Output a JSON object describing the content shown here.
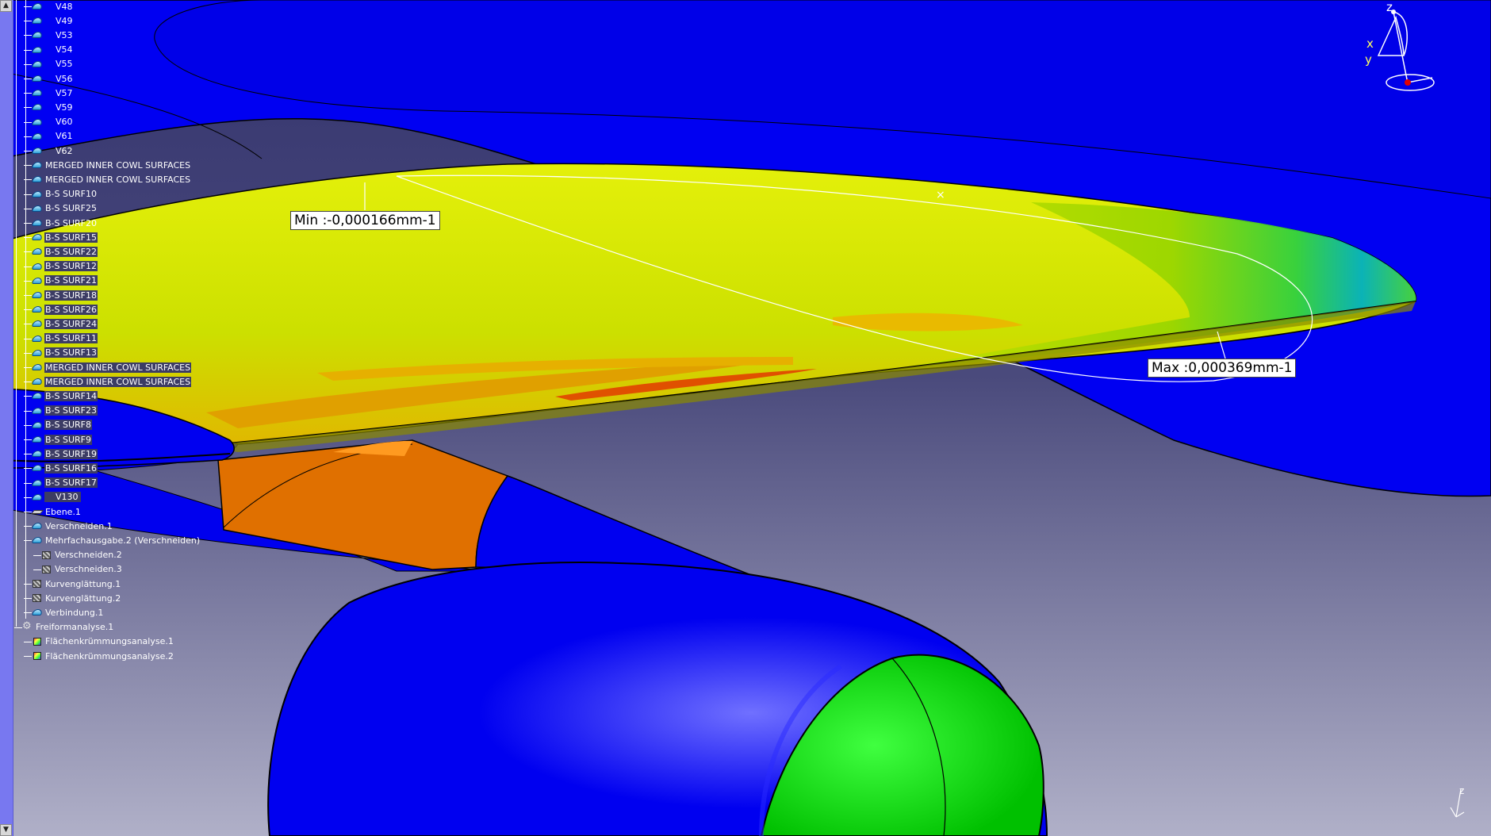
{
  "viewport": {
    "colors": {
      "background_top": "#3a3a72",
      "background_bottom": "#a8a8c4",
      "surface_blue": "#0000f0",
      "pylon_orange": "#e07000",
      "inlet_green": "#00e000"
    }
  },
  "analysis": {
    "min_label": "Min :-0,000166mm-1",
    "max_label": "Max :0,000369mm-1"
  },
  "compass": {
    "z": "z",
    "x": "x",
    "y": "y"
  },
  "mini_axis": {
    "z": "z"
  },
  "tree": {
    "items": [
      {
        "label": "V48",
        "type": "surf",
        "sel": false,
        "level": 1
      },
      {
        "label": "V49",
        "type": "surf",
        "sel": false,
        "level": 1
      },
      {
        "label": "V53",
        "type": "surf",
        "sel": false,
        "level": 1
      },
      {
        "label": "V54",
        "type": "surf",
        "sel": false,
        "level": 1
      },
      {
        "label": "V55",
        "type": "surf",
        "sel": false,
        "level": 1
      },
      {
        "label": "V56",
        "type": "surf",
        "sel": false,
        "level": 1
      },
      {
        "label": "V57",
        "type": "surf",
        "sel": false,
        "level": 1
      },
      {
        "label": "V59",
        "type": "surf",
        "sel": false,
        "level": 1
      },
      {
        "label": "V60",
        "type": "surf",
        "sel": false,
        "level": 1
      },
      {
        "label": "V61",
        "type": "surf",
        "sel": false,
        "level": 1
      },
      {
        "label": "V62",
        "type": "surf",
        "sel": false,
        "level": 1
      },
      {
        "label": "MERGED INNER COWL SURFACES",
        "type": "surf",
        "sel": false,
        "level": 1
      },
      {
        "label": "MERGED INNER COWL SURFACES",
        "type": "surf",
        "sel": false,
        "level": 1
      },
      {
        "label": "B-S SURF10",
        "type": "surf",
        "sel": false,
        "level": 1
      },
      {
        "label": "B-S SURF25",
        "type": "surf",
        "sel": false,
        "level": 1
      },
      {
        "label": "B-S SURF20",
        "type": "surf",
        "sel": false,
        "level": 1
      },
      {
        "label": "B-S SURF15",
        "type": "surf",
        "sel": true,
        "level": 1
      },
      {
        "label": "B-S SURF22",
        "type": "surf",
        "sel": true,
        "level": 1
      },
      {
        "label": "B-S SURF12",
        "type": "surf",
        "sel": true,
        "level": 1
      },
      {
        "label": "B-S SURF21",
        "type": "surf",
        "sel": true,
        "level": 1
      },
      {
        "label": "B-S SURF18",
        "type": "surf",
        "sel": true,
        "level": 1
      },
      {
        "label": "B-S SURF26",
        "type": "surf",
        "sel": true,
        "level": 1
      },
      {
        "label": "B-S SURF24",
        "type": "surf",
        "sel": true,
        "level": 1
      },
      {
        "label": "B-S SURF11",
        "type": "surf",
        "sel": true,
        "level": 1
      },
      {
        "label": "B-S SURF13",
        "type": "surf",
        "sel": true,
        "level": 1
      },
      {
        "label": "MERGED INNER COWL SURFACES",
        "type": "surf",
        "sel": true,
        "level": 1
      },
      {
        "label": "MERGED INNER COWL SURFACES",
        "type": "surf",
        "sel": true,
        "level": 1
      },
      {
        "label": "B-S SURF14",
        "type": "surf",
        "sel": true,
        "level": 1
      },
      {
        "label": "B-S SURF23",
        "type": "surf",
        "sel": true,
        "level": 1
      },
      {
        "label": "B-S SURF8",
        "type": "surf",
        "sel": true,
        "level": 1
      },
      {
        "label": "B-S SURF9",
        "type": "surf",
        "sel": true,
        "level": 1
      },
      {
        "label": "B-S SURF19",
        "type": "surf",
        "sel": true,
        "level": 1
      },
      {
        "label": "B-S SURF16",
        "type": "surf",
        "sel": true,
        "level": 1
      },
      {
        "label": "B-S SURF17",
        "type": "surf",
        "sel": true,
        "level": 1
      },
      {
        "label": "V130",
        "type": "surf",
        "sel": true,
        "level": 1
      },
      {
        "label": "Ebene.1",
        "type": "plane",
        "sel": false,
        "level": 1
      },
      {
        "label": "Verschneiden.1",
        "type": "surf",
        "sel": false,
        "level": 1
      },
      {
        "label": "Mehrfachausgabe.2 (Verschneiden)",
        "type": "surf",
        "sel": false,
        "level": 1
      },
      {
        "label": "Verschneiden.2",
        "type": "op",
        "sel": false,
        "level": 2
      },
      {
        "label": "Verschneiden.3",
        "type": "op",
        "sel": false,
        "level": 2
      },
      {
        "label": "Kurvenglättung.1",
        "type": "op",
        "sel": false,
        "level": 1
      },
      {
        "label": "Kurvenglättung.2",
        "type": "op",
        "sel": false,
        "level": 1
      },
      {
        "label": "Verbindung.1",
        "type": "surf",
        "sel": false,
        "level": 1
      },
      {
        "label": "Freiformanalyse.1",
        "type": "gear",
        "sel": false,
        "level": 0
      },
      {
        "label": "Flächenkrümmungsanalyse.1",
        "type": "analysis",
        "sel": false,
        "level": 1
      },
      {
        "label": "Flächenkrümmungsanalyse.2",
        "type": "analysis",
        "sel": false,
        "level": 1
      }
    ]
  }
}
